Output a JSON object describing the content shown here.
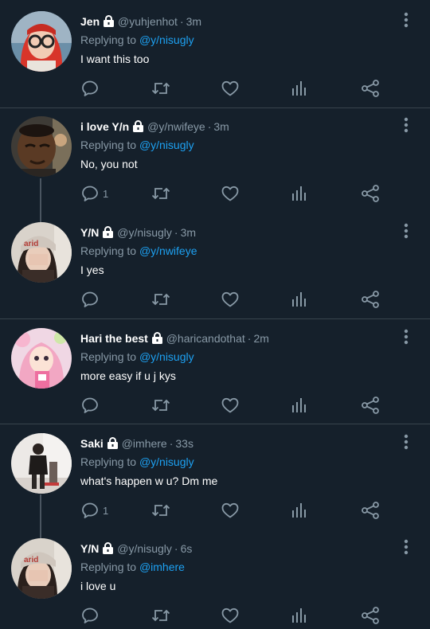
{
  "tweets": [
    {
      "name": "Jen",
      "handle": "@yuhjenhot",
      "time": "3m",
      "replying_prefix": "Replying to",
      "replying_to": "@y/nisugly",
      "text": "I want this too",
      "reply_count": "",
      "avatar": "red-hair-glasses"
    },
    {
      "name": "i love Y/n",
      "handle": "@y/nwifeye",
      "time": "3m",
      "replying_prefix": "Replying to",
      "replying_to": "@y/nisugly",
      "text": "No, you not",
      "reply_count": "1",
      "avatar": "man-squinting"
    },
    {
      "name": "Y/N",
      "handle": "@y/nisugly",
      "time": "3m",
      "replying_prefix": "Replying to",
      "replying_to": "@y/nwifeye",
      "text": "I yes",
      "reply_count": "",
      "avatar": "girl-beanie"
    },
    {
      "name": "Hari the best",
      "handle": "@haricandothat",
      "time": "2m",
      "replying_prefix": "Replying to",
      "replying_to": "@y/nisugly",
      "text": "more easy if u j kys",
      "reply_count": "",
      "avatar": "pink-doll"
    },
    {
      "name": "Saki",
      "handle": "@imhere",
      "time": "33s",
      "replying_prefix": "Replying to",
      "replying_to": "@y/nisugly",
      "text": "what's happen w u? Dm me",
      "reply_count": "1",
      "avatar": "girl-standing"
    },
    {
      "name": "Y/N",
      "handle": "@y/nisugly",
      "time": "6s",
      "replying_prefix": "Replying to",
      "replying_to": "@imhere",
      "text": "i love u",
      "reply_count": "",
      "avatar": "girl-beanie"
    }
  ],
  "icons": {
    "lock": "lock-icon",
    "more": "more-vertical-icon",
    "reply": "reply-icon",
    "retweet": "retweet-icon",
    "like": "like-icon",
    "analytics": "analytics-icon",
    "share": "share-icon"
  },
  "colors": {
    "background": "#15202b",
    "divider": "#38444d",
    "secondary_text": "#8899a6",
    "link": "#1da1f2",
    "icon": "#8899a6"
  }
}
